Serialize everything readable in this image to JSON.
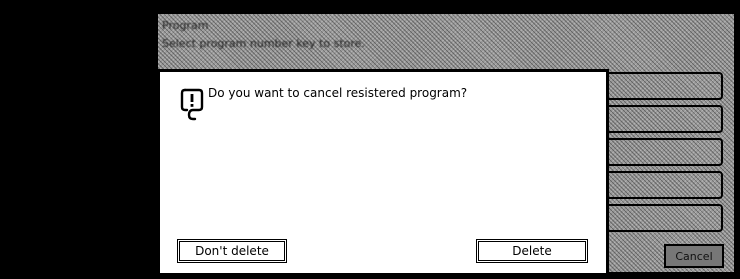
{
  "window": {
    "title": "Program",
    "subtitle": "Select program number key to store."
  },
  "background": {
    "cancel_label": "Cancel",
    "program_slots": 5
  },
  "dialog": {
    "message": "Do you want to cancel resistered program?",
    "icon": "exclamation-icon",
    "buttons": {
      "dont_delete": "Don't delete",
      "delete": "Delete"
    }
  },
  "colors": {
    "panel_grey": "#9a9a9a",
    "border": "#000000",
    "dialog_bg": "#ffffff"
  }
}
